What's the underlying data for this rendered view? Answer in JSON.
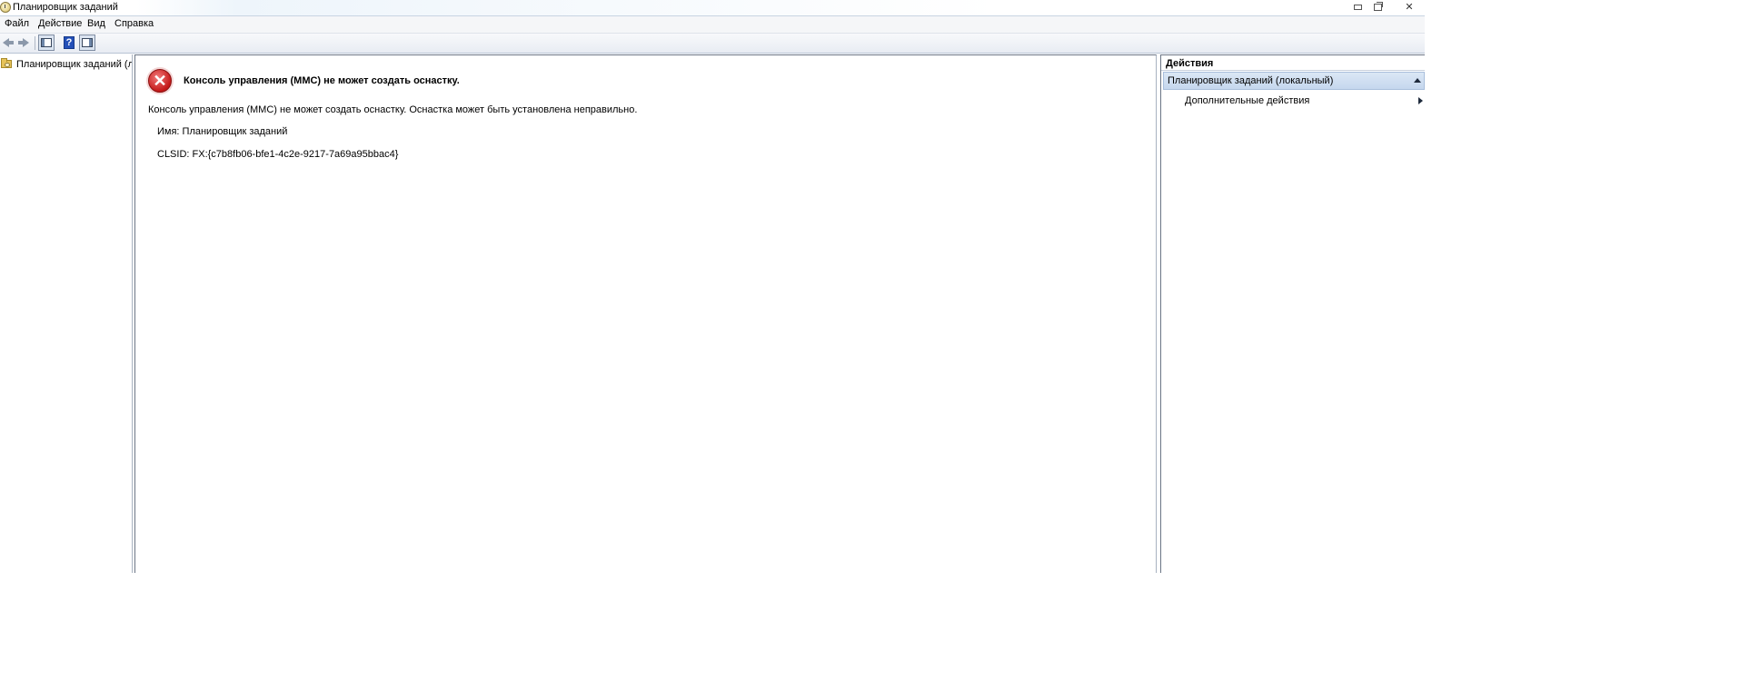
{
  "window": {
    "title": "Планировщик заданий"
  },
  "menubar": {
    "items": [
      "Файл",
      "Действие",
      "Вид",
      "Справка"
    ]
  },
  "toolbar": {
    "help_glyph": "?"
  },
  "tree": {
    "items": [
      {
        "label": "Планировщик заданий (лок"
      }
    ]
  },
  "content": {
    "error_title": "Консоль управления (MMC) не может создать оснастку.",
    "error_description": "Консоль управления (MMC) не может создать оснастку. Оснастка может быть установлена неправильно.",
    "name_line": "Имя: Планировщик заданий",
    "clsid_line": "CLSID: FX:{c7b8fb06-bfe1-4c2e-9217-7a69a95bbac4}",
    "error_glyph": "✕"
  },
  "actions": {
    "header": "Действия",
    "group_title": "Планировщик заданий (локальный)",
    "more_actions": "Дополнительные действия"
  },
  "icons": {
    "app": "task-scheduler-clock-icon",
    "back": "back-arrow-icon",
    "forward": "forward-arrow-icon",
    "console_tree": "show-hide-console-tree-icon",
    "help": "help-icon",
    "action_pane": "show-hide-action-pane-icon",
    "folder": "folder-icon",
    "error": "error-icon"
  },
  "colors": {
    "error_red": "#c41818",
    "selection_blue": "#c5d7ee"
  }
}
